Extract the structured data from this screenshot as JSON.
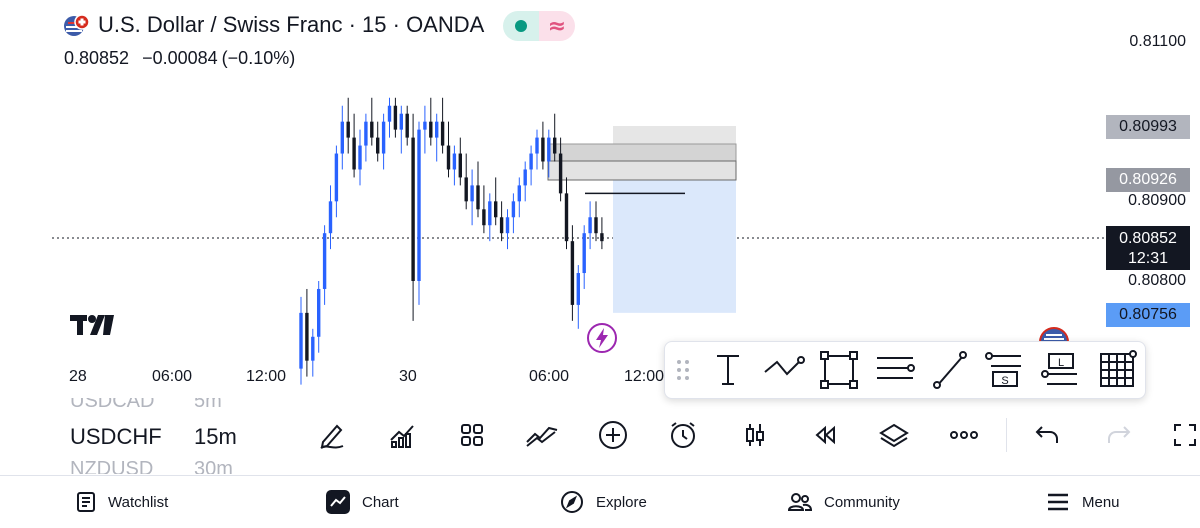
{
  "header": {
    "title": "U.S. Dollar / Swiss Franc · 15 · OANDA",
    "price": "0.80852",
    "change": "−0.00084",
    "change_pct": "(−0.10%)",
    "flag_icon": "us-ch-flag-icon",
    "market_status_icon": "market-open-dot-icon",
    "session_icon": "approx-icon-badge"
  },
  "price_axis": {
    "labels": [
      "0.81100",
      "0.80900",
      "0.80800"
    ],
    "tags": [
      {
        "value": "0.80993",
        "bg": "#b2b5be",
        "fg": "#131722"
      },
      {
        "value": "0.80926",
        "bg": "#9598a1",
        "fg": "#ffffff"
      },
      {
        "value": "0.80756",
        "bg": "#5b9cf6",
        "fg": "#131722"
      }
    ],
    "current": {
      "value": "0.80852",
      "countdown": "12:31",
      "bg": "#131722",
      "fg": "#ffffff"
    }
  },
  "time_axis": [
    "28",
    "06:00",
    "12:00",
    "30",
    "06:00",
    "12:00"
  ],
  "chart_data": {
    "type": "candlestick",
    "symbol": "USDCHF",
    "interval": "15m",
    "ylim": [
      0.8067,
      0.8112
    ],
    "up_color": "#2962ff",
    "down_color": "#131722",
    "last_price": 0.80852,
    "candles": [
      [
        0.8069,
        0.8078,
        0.8067,
        0.8076
      ],
      [
        0.8076,
        0.8079,
        0.8068,
        0.807
      ],
      [
        0.807,
        0.8074,
        0.8068,
        0.8073
      ],
      [
        0.8073,
        0.808,
        0.8071,
        0.8079
      ],
      [
        0.8079,
        0.8087,
        0.8077,
        0.8086
      ],
      [
        0.8086,
        0.8092,
        0.8084,
        0.809
      ],
      [
        0.809,
        0.8097,
        0.8088,
        0.8096
      ],
      [
        0.8096,
        0.8102,
        0.8094,
        0.81
      ],
      [
        0.81,
        0.8103,
        0.8096,
        0.8098
      ],
      [
        0.8098,
        0.8101,
        0.8093,
        0.8094
      ],
      [
        0.8094,
        0.8099,
        0.8092,
        0.8097
      ],
      [
        0.8097,
        0.8101,
        0.8095,
        0.81
      ],
      [
        0.81,
        0.8103,
        0.8097,
        0.8098
      ],
      [
        0.8098,
        0.81,
        0.8095,
        0.8096
      ],
      [
        0.8096,
        0.8101,
        0.8094,
        0.81
      ],
      [
        0.81,
        0.8103,
        0.8098,
        0.8102
      ],
      [
        0.8102,
        0.8103,
        0.8098,
        0.8099
      ],
      [
        0.8099,
        0.8102,
        0.8096,
        0.8101
      ],
      [
        0.8101,
        0.8102,
        0.8097,
        0.8098
      ],
      [
        0.8098,
        0.8101,
        0.8075,
        0.808
      ],
      [
        0.808,
        0.81,
        0.8077,
        0.8099
      ],
      [
        0.8099,
        0.8102,
        0.8096,
        0.81
      ],
      [
        0.81,
        0.8103,
        0.8097,
        0.8098
      ],
      [
        0.8098,
        0.8101,
        0.8095,
        0.81
      ],
      [
        0.81,
        0.8103,
        0.8096,
        0.8097
      ],
      [
        0.8097,
        0.81,
        0.8093,
        0.8094
      ],
      [
        0.8094,
        0.8097,
        0.8092,
        0.8096
      ],
      [
        0.8096,
        0.8098,
        0.8092,
        0.8093
      ],
      [
        0.8093,
        0.8096,
        0.8089,
        0.809
      ],
      [
        0.809,
        0.8094,
        0.8087,
        0.8092
      ],
      [
        0.8092,
        0.8095,
        0.8088,
        0.8089
      ],
      [
        0.8089,
        0.8092,
        0.8086,
        0.8087
      ],
      [
        0.8087,
        0.8091,
        0.8085,
        0.809
      ],
      [
        0.809,
        0.8093,
        0.8087,
        0.8088
      ],
      [
        0.8088,
        0.809,
        0.8085,
        0.8086
      ],
      [
        0.8086,
        0.8089,
        0.8084,
        0.8088
      ],
      [
        0.8088,
        0.8091,
        0.8086,
        0.809
      ],
      [
        0.809,
        0.8093,
        0.8088,
        0.8092
      ],
      [
        0.8092,
        0.8095,
        0.809,
        0.8094
      ],
      [
        0.8094,
        0.8097,
        0.8092,
        0.8096
      ],
      [
        0.8096,
        0.8099,
        0.8094,
        0.8098
      ],
      [
        0.8098,
        0.81,
        0.8094,
        0.8095
      ],
      [
        0.8095,
        0.8099,
        0.8093,
        0.8098
      ],
      [
        0.8098,
        0.8101,
        0.8095,
        0.8096
      ],
      [
        0.8096,
        0.8098,
        0.809,
        0.8091
      ],
      [
        0.8091,
        0.8093,
        0.8084,
        0.8085
      ],
      [
        0.8085,
        0.8087,
        0.8075,
        0.8077
      ],
      [
        0.8077,
        0.8082,
        0.8074,
        0.8081
      ],
      [
        0.8081,
        0.8087,
        0.8079,
        0.8086
      ],
      [
        0.8086,
        0.809,
        0.8084,
        0.8088
      ],
      [
        0.8088,
        0.809,
        0.8085,
        0.8086
      ],
      [
        0.8086,
        0.8088,
        0.8084,
        0.8085
      ]
    ]
  },
  "drawings": {
    "rect_top": {
      "from": 0.81,
      "to": 0.8094,
      "color": "#d1d4dc"
    },
    "long_target_zone": {
      "from": 0.8099,
      "to": 0.8076,
      "color": "#bbd6fb"
    },
    "line_level": 0.8091
  },
  "tool_panel": {
    "items": [
      "drag-handle-icon",
      "text-tool-icon",
      "trend-line-tool-icon",
      "rectangle-tool-icon",
      "horizontal-ray-tool-icon",
      "ray-tool-icon",
      "short-position-tool-icon",
      "long-position-tool-icon",
      "grid-tool-icon"
    ],
    "short_label": "S",
    "long_label": "L"
  },
  "symbols": {
    "prev": {
      "symbol": "USDCAD",
      "interval": "5m"
    },
    "current": {
      "symbol": "USDCHF",
      "interval": "15m"
    },
    "next": {
      "symbol": "NZDUSD",
      "interval": "30m"
    }
  },
  "toolbar_icons": [
    "draw-pencil-icon",
    "indicators-icon",
    "layout-grid-icon",
    "compare-icon",
    "add-circle-icon",
    "alert-clock-icon",
    "candles-icon",
    "replay-icon",
    "layers-icon",
    "more-icon",
    "undo-icon",
    "redo-icon",
    "fullscreen-icon"
  ],
  "nav": {
    "watchlist": "Watchlist",
    "chart": "Chart",
    "explore": "Explore",
    "community": "Community",
    "menu": "Menu"
  }
}
